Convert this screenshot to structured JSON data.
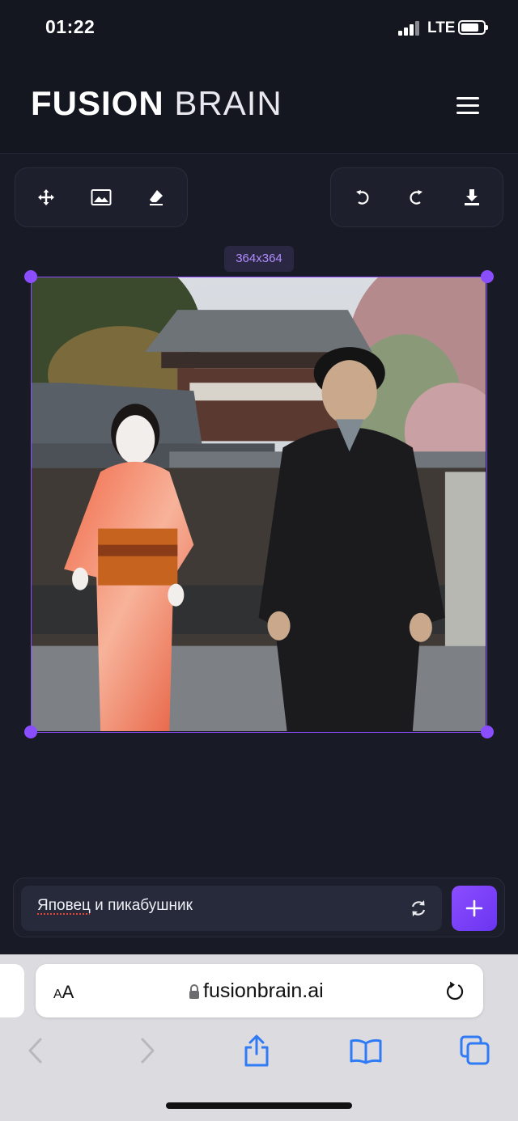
{
  "status_bar": {
    "time": "01:22",
    "network": "LTE"
  },
  "header": {
    "brand_bold": "FUSION",
    "brand_light": "BRAIN",
    "menu_icon": "hamburger-menu-icon"
  },
  "toolbar_left": {
    "icons": [
      "move-icon",
      "image-icon",
      "eraser-icon"
    ]
  },
  "toolbar_right": {
    "icons": [
      "undo-icon",
      "redo-icon",
      "download-icon"
    ]
  },
  "canvas": {
    "size_label": "364x364",
    "accent_color": "#8a4dff"
  },
  "prompt": {
    "text_misspelled": "Яповец",
    "text_rest": " и пикабушник",
    "refresh_icon": "refresh-icon",
    "add_icon": "plus-icon"
  },
  "browser": {
    "text_size_small": "A",
    "text_size_large": "A",
    "url": "fusionbrain.ai",
    "nav_icons": [
      "back-icon",
      "forward-icon",
      "share-icon",
      "bookmarks-icon",
      "tabs-icon"
    ],
    "accent_color": "#2f7bf5"
  }
}
